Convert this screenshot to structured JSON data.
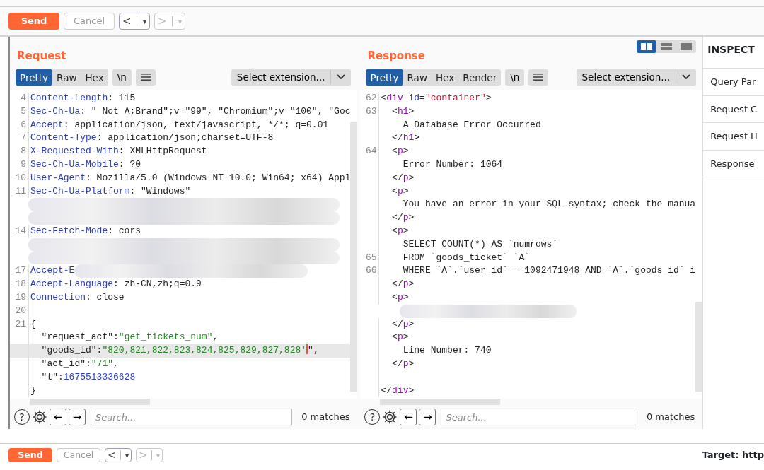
{
  "toolbar": {
    "send": "Send",
    "cancel": "Cancel",
    "back": "<",
    "forward": ">",
    "dropdown": "▾",
    "back_disabled": false,
    "forward_disabled": true
  },
  "request": {
    "title": "Request",
    "tabs": [
      {
        "label": "Pretty",
        "selected": true
      },
      {
        "label": "Raw",
        "selected": false
      },
      {
        "label": "Hex",
        "selected": false
      }
    ],
    "newline_button": "\\n",
    "extension_select": "Select extension...",
    "lines": [
      {
        "kind": "code",
        "num": "4",
        "parts": [
          {
            "t": "Content-Length",
            "kind": "name"
          },
          {
            "t": ": 115",
            "kind": "plain"
          }
        ]
      },
      {
        "kind": "code",
        "num": "5",
        "parts": [
          {
            "t": "Sec-Ch-Ua",
            "kind": "name"
          },
          {
            "t": ": \" Not A;Brand\";v=\"99\", \"Chromium\";v=\"100\", \"Goc",
            "kind": "plain"
          }
        ]
      },
      {
        "kind": "code",
        "num": "6",
        "parts": [
          {
            "t": "Accept",
            "kind": "name"
          },
          {
            "t": ": application/json, text/javascript, */*; q=0.01",
            "kind": "plain"
          }
        ]
      },
      {
        "kind": "code",
        "num": "7",
        "parts": [
          {
            "t": "Content-Type",
            "kind": "name"
          },
          {
            "t": ": application/json;charset=UTF-8",
            "kind": "plain"
          }
        ]
      },
      {
        "kind": "code",
        "num": "8",
        "parts": [
          {
            "t": "X-Requested-With",
            "kind": "name"
          },
          {
            "t": ": XMLHttpRequest",
            "kind": "plain"
          }
        ]
      },
      {
        "kind": "code",
        "num": "9",
        "parts": [
          {
            "t": "Sec-Ch-Ua-Mobile",
            "kind": "name"
          },
          {
            "t": ": ?0",
            "kind": "plain"
          }
        ]
      },
      {
        "kind": "code",
        "num": "10",
        "parts": [
          {
            "t": "User-Agent",
            "kind": "name"
          },
          {
            "t": ": Mozilla/5.0 (Windows NT 10.0; Win64; x64) Appl",
            "kind": "plain"
          }
        ]
      },
      {
        "kind": "code",
        "num": "11",
        "parts": [
          {
            "t": "Sec-Ch-Ua-Platform",
            "kind": "name"
          },
          {
            "t": ": \"Windows\"",
            "kind": "plain"
          }
        ]
      },
      {
        "kind": "blurred"
      },
      {
        "kind": "blurred"
      },
      {
        "kind": "code",
        "num": "14",
        "parts": [
          {
            "t": "Sec-Fetch-Mode",
            "kind": "name"
          },
          {
            "t": ": cors",
            "kind": "plain"
          }
        ]
      },
      {
        "kind": "blurred"
      },
      {
        "kind": "blurred"
      },
      {
        "kind": "code",
        "num": "17",
        "parts": [
          {
            "t": "Accept-E",
            "kind": "name"
          }
        ],
        "blurred_tail": true
      },
      {
        "kind": "code",
        "num": "18",
        "parts": [
          {
            "t": "Accept-Language",
            "kind": "name"
          },
          {
            "t": ": zh-CN,zh;q=0.9",
            "kind": "plain"
          }
        ]
      },
      {
        "kind": "code",
        "num": "19",
        "parts": [
          {
            "t": "Connection",
            "kind": "name"
          },
          {
            "t": ": close",
            "kind": "plain"
          }
        ]
      },
      {
        "kind": "code",
        "num": "20"
      },
      {
        "kind": "code",
        "num": "21",
        "parts": [
          {
            "t": "{",
            "kind": "plain"
          }
        ]
      },
      {
        "kind": "code",
        "parts": [
          {
            "t": "  \"request_act\":",
            "kind": "plain"
          },
          {
            "t": "\"get_tickets_num\"",
            "kind": "string"
          },
          {
            "t": ",",
            "kind": "plain"
          }
        ]
      },
      {
        "kind": "code",
        "highlighted": true,
        "parts": [
          {
            "t": "  \"goods_id\":",
            "kind": "plain"
          },
          {
            "t": "\"820,821,822,823,824,825,829,827,828'",
            "kind": "string"
          },
          {
            "kind": "caret"
          },
          {
            "t": "\",",
            "kind": "plain"
          }
        ]
      },
      {
        "kind": "code",
        "parts": [
          {
            "t": "  \"act_id\":",
            "kind": "plain"
          },
          {
            "t": "\"71\"",
            "kind": "string"
          },
          {
            "t": ",",
            "kind": "plain"
          }
        ]
      },
      {
        "kind": "code",
        "parts": [
          {
            "t": "  \"t\":",
            "kind": "plain"
          },
          {
            "t": "1675513336628",
            "kind": "number"
          }
        ]
      },
      {
        "kind": "code",
        "parts": [
          {
            "t": "}",
            "kind": "plain"
          }
        ]
      }
    ],
    "search": {
      "help": "?",
      "prev": "←",
      "next": "→",
      "placeholder": "Search...",
      "matches": "0 matches"
    }
  },
  "response": {
    "title": "Response",
    "layout_buttons": [
      {
        "selected": true,
        "kind": "split"
      },
      {
        "selected": false,
        "kind": "stacked"
      },
      {
        "selected": false,
        "kind": "single"
      }
    ],
    "tabs": [
      {
        "label": "Pretty",
        "selected": true
      },
      {
        "label": "Raw",
        "selected": false
      },
      {
        "label": "Hex",
        "selected": false
      },
      {
        "label": "Render",
        "selected": false
      }
    ],
    "newline_button": "\\n",
    "extension_select": "Select extension...",
    "lines": [
      {
        "kind": "code",
        "num": "62",
        "parts": [
          {
            "t": "<",
            "kind": "punct"
          },
          {
            "t": "div",
            "kind": "tag"
          },
          {
            "t": " id",
            "kind": "attr"
          },
          {
            "t": "=",
            "kind": "punct"
          },
          {
            "t": "\"container\"",
            "kind": "attrval"
          },
          {
            "t": ">",
            "kind": "punct"
          }
        ]
      },
      {
        "kind": "code",
        "num": "63",
        "parts": [
          {
            "t": "  <",
            "kind": "punct"
          },
          {
            "t": "h1",
            "kind": "tag"
          },
          {
            "t": ">",
            "kind": "punct"
          }
        ]
      },
      {
        "kind": "code",
        "parts": [
          {
            "t": "    A Database Error Occurred",
            "kind": "plain"
          }
        ]
      },
      {
        "kind": "code",
        "parts": [
          {
            "t": "  </",
            "kind": "punct"
          },
          {
            "t": "h1",
            "kind": "tag"
          },
          {
            "t": ">",
            "kind": "punct"
          }
        ]
      },
      {
        "kind": "code",
        "num": "64",
        "parts": [
          {
            "t": "  <",
            "kind": "punct"
          },
          {
            "t": "p",
            "kind": "tag"
          },
          {
            "t": ">",
            "kind": "punct"
          }
        ]
      },
      {
        "kind": "code",
        "parts": [
          {
            "t": "    Error Number: 1064",
            "kind": "plain"
          }
        ]
      },
      {
        "kind": "code",
        "parts": [
          {
            "t": "  </",
            "kind": "punct"
          },
          {
            "t": "p",
            "kind": "tag"
          },
          {
            "t": ">",
            "kind": "punct"
          }
        ]
      },
      {
        "kind": "code",
        "parts": [
          {
            "t": "  <",
            "kind": "punct"
          },
          {
            "t": "p",
            "kind": "tag"
          },
          {
            "t": ">",
            "kind": "punct"
          }
        ]
      },
      {
        "kind": "code",
        "parts": [
          {
            "t": "    You have an error in your SQL syntax; check the manua",
            "kind": "plain"
          }
        ]
      },
      {
        "kind": "code",
        "parts": [
          {
            "t": "  </",
            "kind": "punct"
          },
          {
            "t": "p",
            "kind": "tag"
          },
          {
            "t": ">",
            "kind": "punct"
          }
        ]
      },
      {
        "kind": "code",
        "parts": [
          {
            "t": "  <",
            "kind": "punct"
          },
          {
            "t": "p",
            "kind": "tag"
          },
          {
            "t": ">",
            "kind": "punct"
          }
        ]
      },
      {
        "kind": "code",
        "parts": [
          {
            "t": "    SELECT COUNT(*) AS `numrows`",
            "kind": "plain"
          }
        ]
      },
      {
        "kind": "code",
        "num": "65",
        "parts": [
          {
            "t": "    FROM `goods_ticket` `A`",
            "kind": "plain"
          }
        ]
      },
      {
        "kind": "code",
        "num": "66",
        "parts": [
          {
            "t": "    WHERE `A`.`user_id` = 1092471948 AND `A`.`goods_id` i",
            "kind": "plain"
          }
        ]
      },
      {
        "kind": "code",
        "parts": [
          {
            "t": "  </",
            "kind": "punct"
          },
          {
            "t": "p",
            "kind": "tag"
          },
          {
            "t": ">",
            "kind": "punct"
          }
        ]
      },
      {
        "kind": "code",
        "parts": [
          {
            "t": "  <",
            "kind": "punct"
          },
          {
            "t": "p",
            "kind": "tag"
          },
          {
            "t": ">",
            "kind": "punct"
          }
        ]
      },
      {
        "kind": "blurred"
      },
      {
        "kind": "code",
        "parts": [
          {
            "t": "  </",
            "kind": "punct"
          },
          {
            "t": "p",
            "kind": "tag"
          },
          {
            "t": ">",
            "kind": "punct"
          }
        ]
      },
      {
        "kind": "code",
        "parts": [
          {
            "t": "  <",
            "kind": "punct"
          },
          {
            "t": "p",
            "kind": "tag"
          },
          {
            "t": ">",
            "kind": "punct"
          }
        ]
      },
      {
        "kind": "code",
        "parts": [
          {
            "t": "    Line Number: 740",
            "kind": "plain"
          }
        ]
      },
      {
        "kind": "code",
        "parts": [
          {
            "t": "  </",
            "kind": "punct"
          },
          {
            "t": "p",
            "kind": "tag"
          },
          {
            "t": ">",
            "kind": "punct"
          }
        ]
      },
      {
        "kind": "code"
      },
      {
        "kind": "code",
        "parts": [
          {
            "t": "</",
            "kind": "punct"
          },
          {
            "t": "div",
            "kind": "tag"
          },
          {
            "t": ">",
            "kind": "punct"
          }
        ]
      }
    ],
    "search": {
      "help": "?",
      "prev": "←",
      "next": "→",
      "placeholder": "Search...",
      "matches": "0 matches"
    }
  },
  "inspector": {
    "title": "INSPECT",
    "items": [
      "Query Par",
      "Request C",
      "Request H",
      "Response"
    ]
  },
  "bottom_toolbar": {
    "send": "Send",
    "cancel": "Cancel",
    "back": "<",
    "forward": ">",
    "dropdown": "▾",
    "back_disabled": false,
    "forward_disabled": true,
    "target": "Target: http"
  }
}
